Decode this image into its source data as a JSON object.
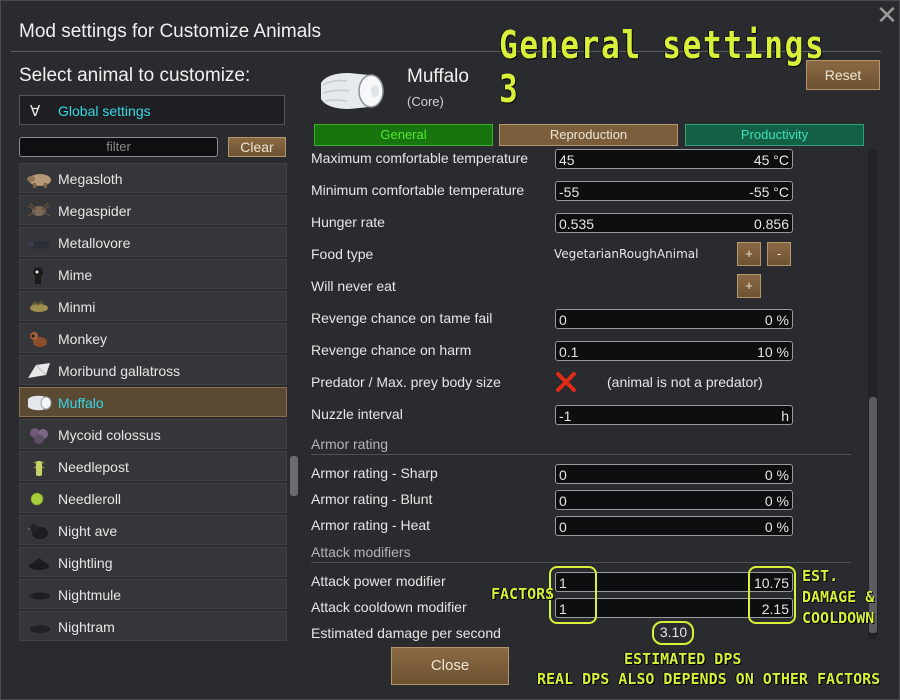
{
  "window": {
    "title": "Mod settings for Customize Animals",
    "close_glyph": "✕"
  },
  "annotations": {
    "header": "General settings 3",
    "factors": "FACTORS",
    "est_damage": [
      "EST.",
      "DAMAGE &",
      "COOLDOWN"
    ],
    "dps_line1": "ESTIMATED DPS",
    "dps_line2": "REAL DPS ALSO DEPENDS ON OTHER FACTORS"
  },
  "sidebar": {
    "select_label": "Select animal to customize:",
    "global": {
      "symbol": "∀",
      "label": "Global settings"
    },
    "filter_placeholder": "filter",
    "clear_label": "Clear",
    "animals": [
      {
        "name": "Megasloth",
        "icon": "megasloth-icon",
        "selected": false
      },
      {
        "name": "Megaspider",
        "icon": "megaspider-icon",
        "selected": false
      },
      {
        "name": "Metallovore",
        "icon": "metallovore-icon",
        "selected": false
      },
      {
        "name": "Mime",
        "icon": "mime-icon",
        "selected": false
      },
      {
        "name": "Minmi",
        "icon": "minmi-icon",
        "selected": false
      },
      {
        "name": "Monkey",
        "icon": "monkey-icon",
        "selected": false
      },
      {
        "name": "Moribund gallatross",
        "icon": "moribund-gallatross-icon",
        "selected": false
      },
      {
        "name": "Muffalo",
        "icon": "muffalo-icon",
        "selected": true
      },
      {
        "name": "Mycoid colossus",
        "icon": "mycoid-colossus-icon",
        "selected": false
      },
      {
        "name": "Needlepost",
        "icon": "needlepost-icon",
        "selected": false
      },
      {
        "name": "Needleroll",
        "icon": "needleroll-icon",
        "selected": false
      },
      {
        "name": "Night ave",
        "icon": "night-ave-icon",
        "selected": false
      },
      {
        "name": "Nightling",
        "icon": "nightling-icon",
        "selected": false
      },
      {
        "name": "Nightmule",
        "icon": "nightmule-icon",
        "selected": false
      },
      {
        "name": "Nightram",
        "icon": "nightram-icon",
        "selected": false
      }
    ]
  },
  "animal": {
    "name": "Muffalo",
    "source": "(Core)",
    "image": "muffalo-icon"
  },
  "reset_label": "Reset",
  "tabs": [
    {
      "label": "General",
      "color": "#56e834"
    },
    {
      "label": "Reproduction",
      "color": "#efe5d5"
    },
    {
      "label": "Productivity",
      "color": "#41e0b8"
    }
  ],
  "settings": {
    "max_temp": {
      "label": "Maximum comfortable temperature",
      "input": "45",
      "display": "45 °C"
    },
    "min_temp": {
      "label": "Minimum comfortable temperature",
      "input": "-55",
      "display": "-55 °C"
    },
    "hunger": {
      "label": "Hunger rate",
      "input": "0.535",
      "display": "0.856"
    },
    "food_type": {
      "label": "Food type",
      "value": "VegetarianRoughAnimal",
      "add": "+",
      "remove": "-"
    },
    "never_eat": {
      "label": "Will never eat",
      "add": "+"
    },
    "revenge_tame": {
      "label": "Revenge chance on tame fail",
      "input": "0",
      "display": "0 %"
    },
    "revenge_harm": {
      "label": "Revenge chance on harm",
      "input": "0.1",
      "display": "10 %"
    },
    "predator": {
      "label": "Predator / Max. prey body size",
      "note": "(animal is not a predator)",
      "icon": "red-x-icon"
    },
    "nuzzle": {
      "label": "Nuzzle interval",
      "input": "-1",
      "display": "h"
    }
  },
  "armor": {
    "section": "Armor rating",
    "sharp": {
      "label": "Armor rating - Sharp",
      "input": "0",
      "display": "0 %"
    },
    "blunt": {
      "label": "Armor rating - Blunt",
      "input": "0",
      "display": "0 %"
    },
    "heat": {
      "label": "Armor rating - Heat",
      "input": "0",
      "display": "0 %"
    }
  },
  "attack": {
    "section": "Attack modifiers",
    "power": {
      "label": "Attack power modifier",
      "input": "1",
      "display": "10.75"
    },
    "cooldown": {
      "label": "Attack cooldown modifier",
      "input": "1",
      "display": "2.15"
    },
    "dps": {
      "label": "Estimated damage per second",
      "value": "3.10"
    }
  },
  "close_label": "Close"
}
